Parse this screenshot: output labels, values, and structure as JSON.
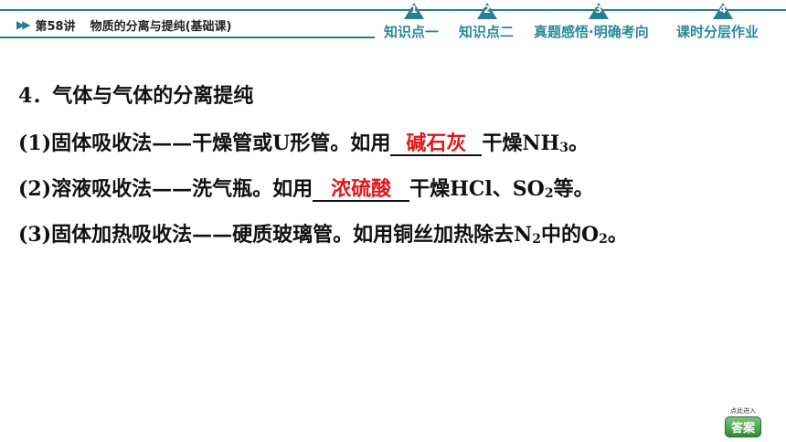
{
  "header": {
    "lesson_label": "第58讲",
    "lesson_title": "物质的分离与提纯(基础课)",
    "nav": [
      {
        "num": "1",
        "label": "知识点一"
      },
      {
        "num": "2",
        "label": "知识点二"
      },
      {
        "num": "3",
        "label": "真题感悟·明确考向"
      },
      {
        "num": "4",
        "label": "课时分层作业"
      }
    ],
    "colors": {
      "accent": "#2a7f8f",
      "nav_text": "#2a8a98",
      "answer": "#e0181c"
    }
  },
  "content": {
    "heading": "4．气体与气体的分离提纯",
    "lines": [
      {
        "pre": "(1)固体吸收法——干燥管或U形管。如用",
        "answer": "碱石灰",
        "post_a": "干燥NH",
        "sub": "3",
        "post_b": "。"
      },
      {
        "pre": "(2)溶液吸收法——洗气瓶。如用",
        "answer": "浓硫酸",
        "post_a": "干燥HCl、SO",
        "sub": "2",
        "post_b": "等。"
      },
      {
        "pre": "(3)固体加热吸收法——硬质玻璃管。如用铜丝加热除去N",
        "sub1": "2",
        "mid": "中的O",
        "sub2": "2",
        "post": "。"
      }
    ]
  },
  "answer_button": {
    "hint": "点此进入",
    "label": "答案"
  }
}
